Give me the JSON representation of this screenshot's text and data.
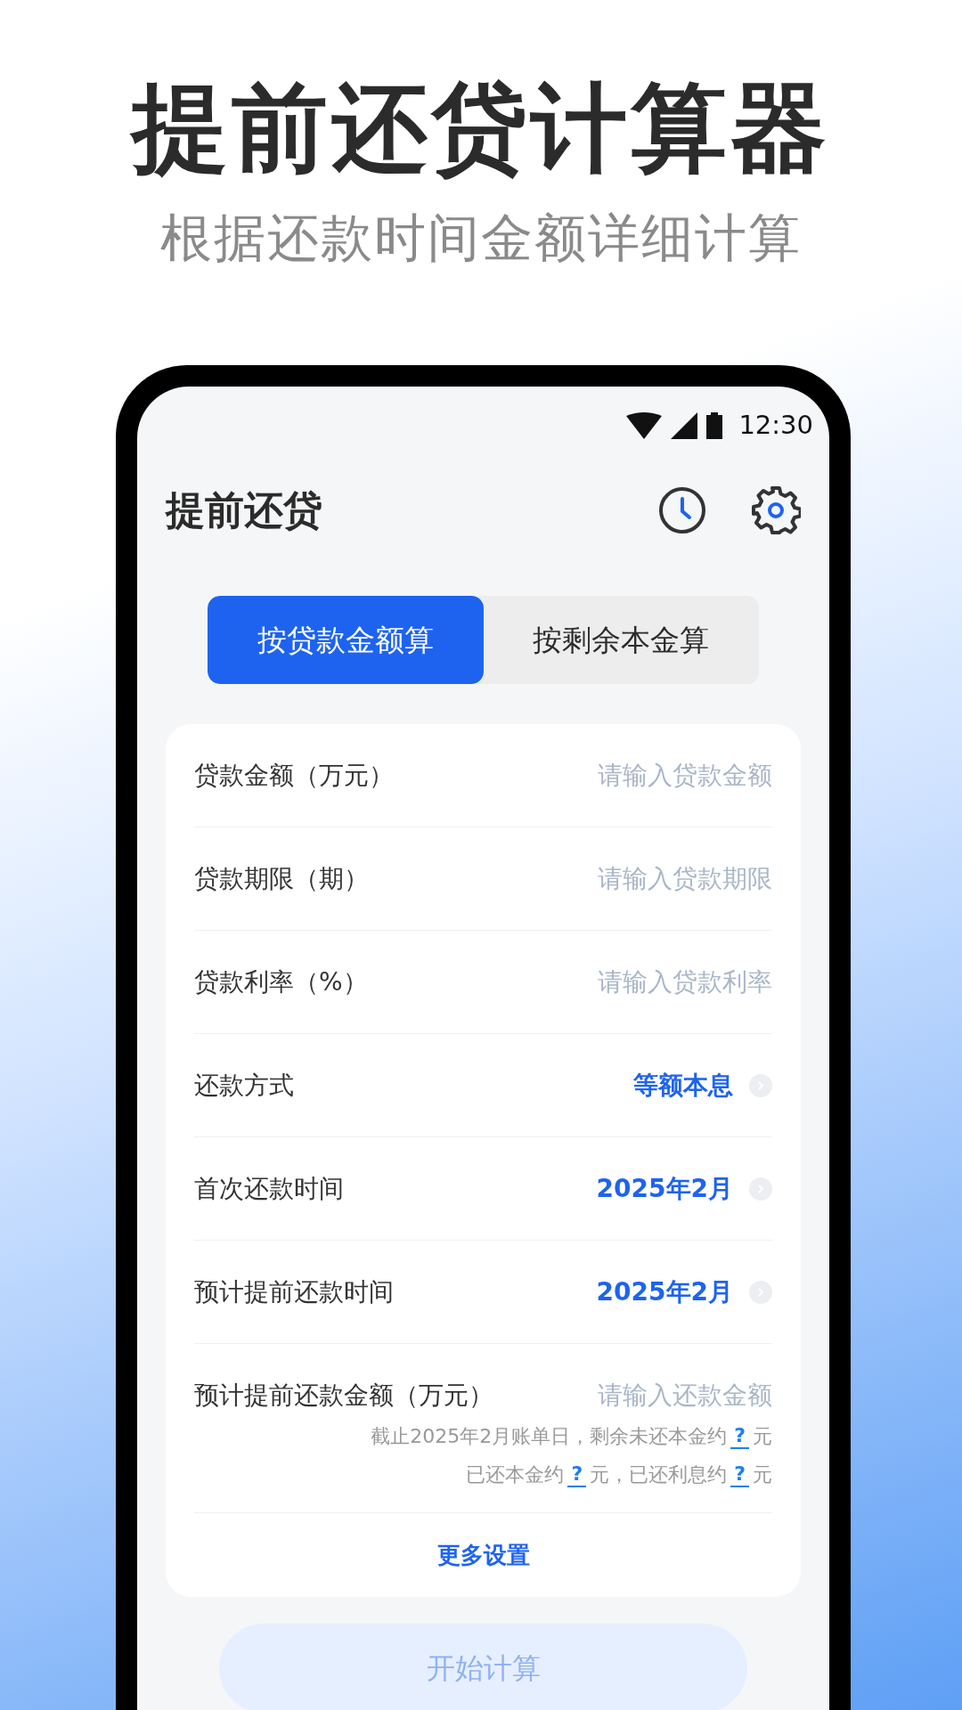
{
  "headline": "提前还贷计算器",
  "subheadline": "根据还款时间金额详细计算",
  "status_bar": {
    "time": "12:30"
  },
  "app": {
    "title": "提前还贷",
    "tabs": [
      {
        "label": "按贷款金额算",
        "selected": true
      },
      {
        "label": "按剩余本金算",
        "selected": false
      }
    ],
    "rows": [
      {
        "kind": "input",
        "label": "贷款金额（万元）",
        "placeholder": "请输入贷款金额"
      },
      {
        "kind": "input",
        "label": "贷款期限（期）",
        "placeholder": "请输入贷款期限"
      },
      {
        "kind": "input",
        "label": "贷款利率（%）",
        "placeholder": "请输入贷款利率"
      },
      {
        "kind": "select",
        "label": "还款方式",
        "value": "等额本息"
      },
      {
        "kind": "select",
        "label": "首次还款时间",
        "value": "2025年2月"
      },
      {
        "kind": "select",
        "label": "预计提前还款时间",
        "value": "2025年2月"
      },
      {
        "kind": "input",
        "label": "预计提前还款金额（万元）",
        "placeholder": "请输入还款金额"
      }
    ],
    "notes": [
      [
        {
          "kind": "text",
          "text": "截止2025年2月账单日，剩余未还本金约"
        },
        {
          "kind": "link",
          "text": "?"
        },
        {
          "kind": "text",
          "text": "元"
        }
      ],
      [
        {
          "kind": "text",
          "text": "已还本金约"
        },
        {
          "kind": "link",
          "text": "?"
        },
        {
          "kind": "text",
          "text": "元，已还利息约"
        },
        {
          "kind": "link",
          "text": "?"
        },
        {
          "kind": "text",
          "text": "元"
        }
      ]
    ],
    "more_link": "更多设置",
    "submit": "开始计算"
  }
}
